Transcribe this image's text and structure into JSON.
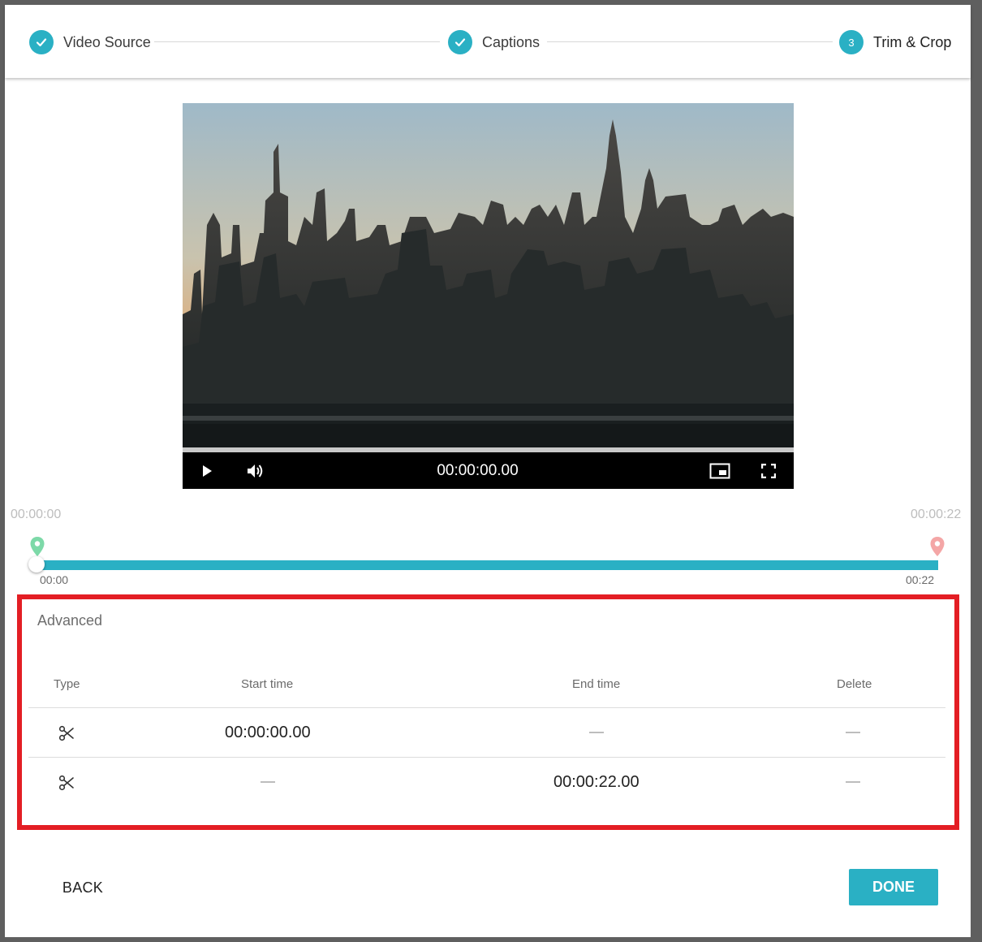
{
  "stepper": {
    "steps": [
      {
        "label": "Video Source",
        "status": "completed"
      },
      {
        "label": "Captions",
        "status": "completed"
      },
      {
        "label": "Trim & Crop",
        "status": "active",
        "number": "3"
      }
    ],
    "accent_color": "#2ab0c4"
  },
  "player": {
    "time": "00:00:00.00",
    "controls": [
      "play-icon",
      "volume-icon",
      "picture-in-picture-icon",
      "fullscreen-icon"
    ]
  },
  "range": {
    "total_start": "00:00:00",
    "total_end": "00:00:22",
    "tick_start": "00:00",
    "tick_end": "00:22",
    "start_pin_color": "#7dd9a8",
    "end_pin_color": "#f4a6a6"
  },
  "advanced": {
    "title": "Advanced",
    "highlight_color": "#e31e24",
    "columns": {
      "type": "Type",
      "start": "Start time",
      "end": "End time",
      "delete": "Delete"
    },
    "rows": [
      {
        "type_icon": "scissors-icon",
        "start": "00:00:00.00",
        "end": "",
        "delete": ""
      },
      {
        "type_icon": "scissors-icon",
        "start": "",
        "end": "00:00:22.00",
        "delete": ""
      }
    ]
  },
  "footer": {
    "back_label": "BACK",
    "done_label": "DONE"
  }
}
